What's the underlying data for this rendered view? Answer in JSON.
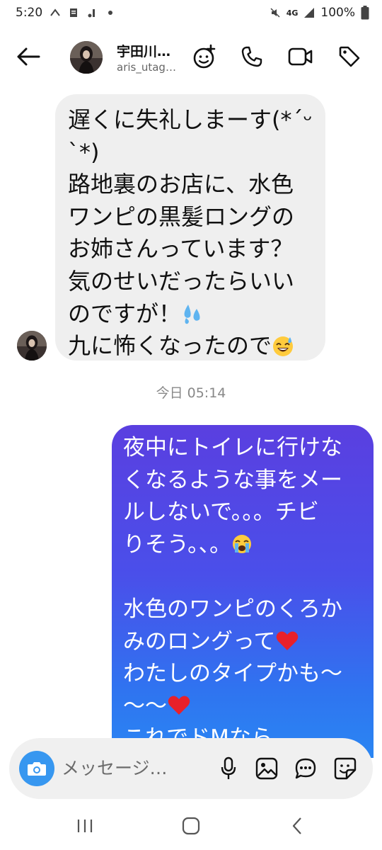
{
  "status_bar": {
    "time": "5:20",
    "network": "4G",
    "battery": "100%"
  },
  "header": {
    "contact_name": "宇田川…",
    "contact_handle": "aris_utag…",
    "icons": [
      "back-arrow-icon",
      "effects-icon",
      "phone-icon",
      "video-camera-icon",
      "tag-icon"
    ]
  },
  "messages": [
    {
      "direction": "incoming",
      "lines": [
        "遅くに失礼しまーす(*´ᵕ",
        "`*)",
        "路地裏のお店に、水色",
        "ワンピの黒髪ロングの",
        "お姉さんっています？",
        "気のせいだったらいい",
        "のですが！",
        "九に怖くなったので"
      ],
      "emojis": [
        "sweat-droplets-emoji",
        "grinning-sweat-emoji"
      ]
    },
    {
      "direction": "outgoing",
      "lines": [
        "夜中にトイレに行けな",
        "くなるような事をメー",
        "ルしないで。。。チビ",
        "りそう。、。",
        "",
        "水色のワンピのくろか",
        "みのロングって",
        "わたしのタイプかも〜",
        "〜〜",
        "これでドMなら"
      ],
      "emojis": [
        "crying-face-emoji",
        "red-heart-emoji",
        "red-heart-emoji"
      ]
    }
  ],
  "timestamp": "今日 05:14",
  "composer": {
    "placeholder": "メッセージ…",
    "icons": [
      "camera-icon",
      "microphone-icon",
      "image-icon",
      "chat-bubble-icon",
      "sticker-icon"
    ]
  },
  "colors": {
    "incoming_bubble": "#efefef",
    "outgoing_gradient_top": "#5a3fe0",
    "outgoing_gradient_bottom": "#2a86f3",
    "accent": "#3797f0"
  }
}
